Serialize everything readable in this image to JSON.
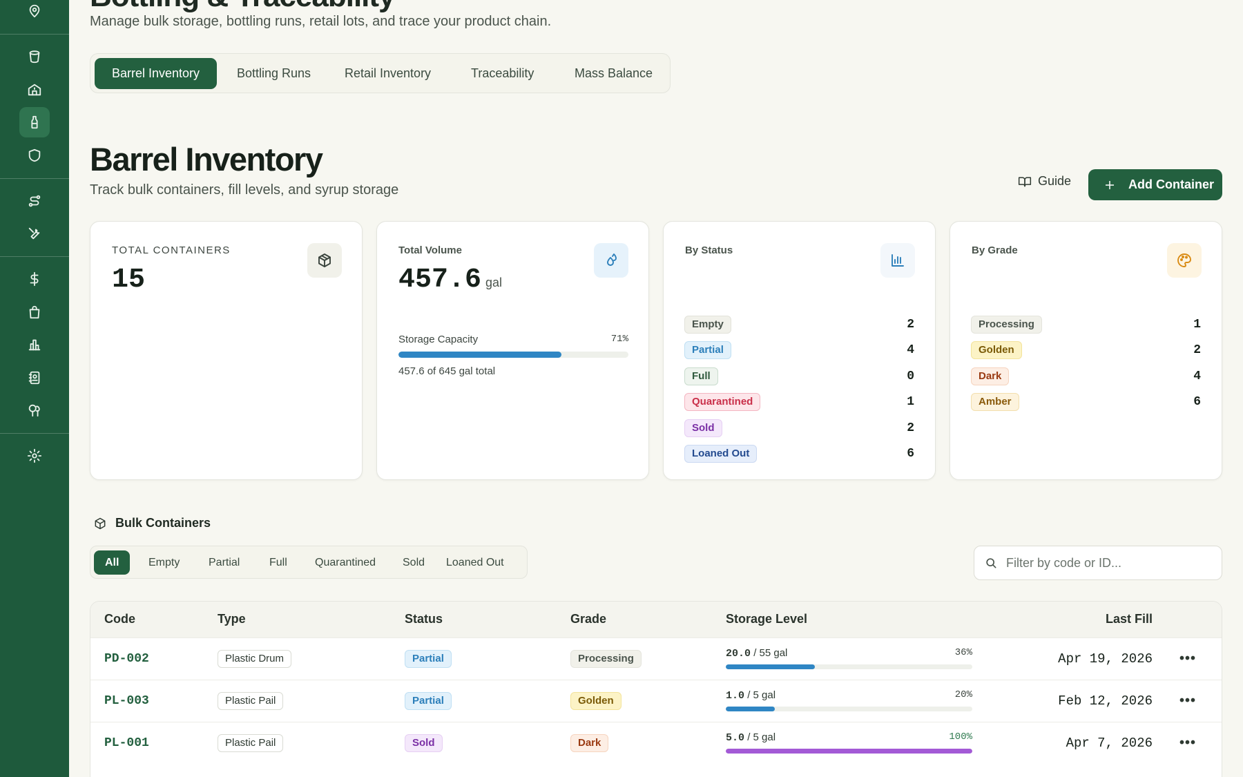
{
  "app": {
    "title": "Bottling & Traceability",
    "subtitle": "Manage bulk storage, bottling runs, retail lots, and trace your product chain."
  },
  "sidebar": {
    "icons": [
      "map-pin-icon",
      "bucket-icon",
      "sugarhouse-icon",
      "bottle-icon",
      "shield-icon",
      "route-icon",
      "tools-icon",
      "dollar-icon",
      "shopping-bag-icon",
      "bar-chart-icon",
      "contacts-icon",
      "trees-icon",
      "gear-icon"
    ],
    "active": "bottle-icon"
  },
  "tabs": [
    "Barrel Inventory",
    "Bottling Runs",
    "Retail Inventory",
    "Traceability",
    "Mass Balance"
  ],
  "page": {
    "title": "Barrel Inventory",
    "subtitle": "Track bulk containers, fill levels, and syrup storage",
    "guide_label": "Guide",
    "add_label": "Add Container"
  },
  "stats": {
    "total_containers": {
      "label": "TOTAL CONTAINERS",
      "value": "15"
    },
    "total_volume": {
      "label": "Total Volume",
      "value": "457.6",
      "unit": "gal",
      "capacity_label": "Storage Capacity",
      "capacity_pct_text": "71%",
      "capacity_fraction": 0.71,
      "capacity_note": "457.6 of 645 gal total"
    },
    "by_status": {
      "label": "By Status",
      "items": [
        {
          "label": "Empty",
          "count": "2",
          "style": "b-empty"
        },
        {
          "label": "Partial",
          "count": "4",
          "style": "b-partial"
        },
        {
          "label": "Full",
          "count": "0",
          "style": "b-full"
        },
        {
          "label": "Quarantined",
          "count": "1",
          "style": "b-quar"
        },
        {
          "label": "Sold",
          "count": "2",
          "style": "b-sold"
        },
        {
          "label": "Loaned Out",
          "count": "6",
          "style": "b-loaned"
        }
      ]
    },
    "by_grade": {
      "label": "By Grade",
      "items": [
        {
          "label": "Processing",
          "count": "1",
          "style": "b-processing"
        },
        {
          "label": "Golden",
          "count": "2",
          "style": "b-golden"
        },
        {
          "label": "Dark",
          "count": "4",
          "style": "b-dark"
        },
        {
          "label": "Amber",
          "count": "6",
          "style": "b-amber"
        }
      ]
    }
  },
  "section": {
    "title": "Bulk Containers",
    "filters": [
      "All",
      "Empty",
      "Partial",
      "Full",
      "Quarantined",
      "Sold",
      "Loaned Out"
    ],
    "active_filter": "All",
    "search_placeholder": "Filter by code or ID..."
  },
  "table": {
    "columns": [
      "Code",
      "Type",
      "Status",
      "Grade",
      "Storage Level",
      "Last Fill"
    ],
    "rows": [
      {
        "code": "PD-002",
        "type": "Plastic Drum",
        "status": "Partial",
        "status_style": "b-partial",
        "grade": "Processing",
        "grade_style": "b-processing",
        "level": "20.0",
        "capacity": "/ 55 gal",
        "pct_text": "36%",
        "pct": 0.36,
        "bar_color": "#2f86c4",
        "date": "Apr 19, 2026"
      },
      {
        "code": "PL-003",
        "type": "Plastic Pail",
        "status": "Partial",
        "status_style": "b-partial",
        "grade": "Golden",
        "grade_style": "b-golden",
        "level": "1.0",
        "capacity": "/ 5 gal",
        "pct_text": "20%",
        "pct": 0.2,
        "bar_color": "#2f86c4",
        "date": "Feb 12, 2026"
      },
      {
        "code": "PL-001",
        "type": "Plastic Pail",
        "status": "Sold",
        "status_style": "b-sold",
        "grade": "Dark",
        "grade_style": "b-dark",
        "level": "5.0",
        "capacity": "/ 5 gal",
        "pct_text": "100%",
        "pct": 1.0,
        "bar_color": "#a35ad6",
        "date": "Apr 7, 2026"
      }
    ]
  },
  "colors": {
    "brand": "#23603f",
    "sidebar": "#1e5a3c",
    "capacity_bar": "#2f86c4"
  }
}
